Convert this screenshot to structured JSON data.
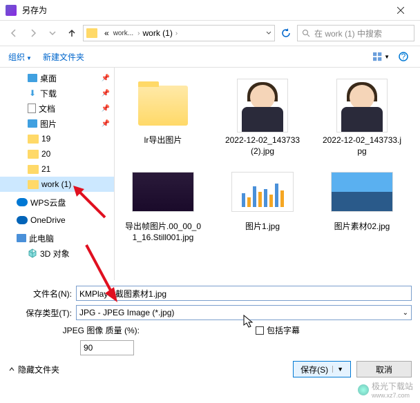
{
  "title": "另存为",
  "breadcrumb": {
    "p1": "work...",
    "p2": "work (1)"
  },
  "search_placeholder": "在 work (1) 中搜索",
  "toolbar": {
    "organize": "组织",
    "new_folder": "新建文件夹"
  },
  "sidebar": {
    "desktop": "桌面",
    "downloads": "下载",
    "documents": "文档",
    "pictures": "图片",
    "f19": "19",
    "f20": "20",
    "f21": "21",
    "work1": "work (1)",
    "wps": "WPS云盘",
    "onedrive": "OneDrive",
    "thispc": "此电脑",
    "objects3d": "3D 对象"
  },
  "files": {
    "f1": "lr导出图片",
    "f2": "2022-12-02_143733 (2).jpg",
    "f3": "2022-12-02_143733.jpg",
    "f4": "导出帧图片.00_00_01_16.Still001.jpg",
    "f5": "图片1.jpg",
    "f6": "图片素材02.jpg"
  },
  "form": {
    "filename_label": "文件名(N):",
    "filename_value": "KMPlayer截图素材1.jpg",
    "filetype_label": "保存类型(T):",
    "filetype_value": "JPG - JPEG Image (*.jpg)",
    "quality_label": "JPEG 图像 质量 (%):",
    "quality_value": "90",
    "subtitle": "包括字幕"
  },
  "footer": {
    "hide_folders": "隐藏文件夹",
    "save": "保存(S)",
    "cancel": "取消"
  },
  "watermark": {
    "name": "极光下载站",
    "url": "www.xz7.com"
  }
}
